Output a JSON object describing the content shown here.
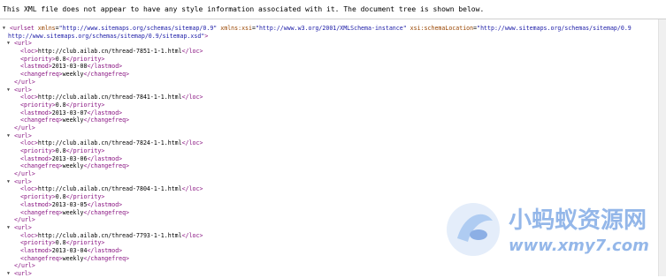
{
  "info_message": "This XML file does not appear to have any style information associated with it. The document tree is shown below.",
  "urlset": {
    "open_tag": "urlset",
    "attrs": [
      {
        "name": "xmlns",
        "value": "\"http://www.sitemaps.org/schemas/sitemap/0.9\""
      },
      {
        "name": "xmlns:xsi",
        "value": "\"http://www.w3.org/2001/XMLSchema-instance\""
      },
      {
        "name": "xsi:schemaLocation",
        "value": "\"http://www.sitemaps.org/schemas/sitemap/0.9"
      }
    ],
    "schema_cont": "http://www.sitemaps.org/schemas/sitemap/0.9/sitemap.xsd\""
  },
  "urls": [
    {
      "loc": "http://club.ailab.cn/thread-7851-1-1.html",
      "priority": "0.8",
      "lastmod": "2013-03-08",
      "changefreq": "weekly"
    },
    {
      "loc": "http://club.ailab.cn/thread-7841-1-1.html",
      "priority": "0.8",
      "lastmod": "2013-03-07",
      "changefreq": "weekly"
    },
    {
      "loc": "http://club.ailab.cn/thread-7824-1-1.html",
      "priority": "0.8",
      "lastmod": "2013-03-06",
      "changefreq": "weekly"
    },
    {
      "loc": "http://club.ailab.cn/thread-7804-1-1.html",
      "priority": "0.8",
      "lastmod": "2013-03-05",
      "changefreq": "weekly"
    },
    {
      "loc": "http://club.ailab.cn/thread-7793-1-1.html",
      "priority": "0.8",
      "lastmod": "2013-03-04",
      "changefreq": "weekly"
    }
  ],
  "tags": {
    "url": "url",
    "loc": "loc",
    "priority": "priority",
    "lastmod": "lastmod",
    "changefreq": "changefreq"
  },
  "watermark": {
    "cn": "小蚂蚁资源网",
    "url": "www.xmy7.com"
  },
  "colors": {
    "tag": "#881280",
    "attr": "#994500",
    "value": "#1a1aa6",
    "watermark": "#3d7dd8"
  }
}
